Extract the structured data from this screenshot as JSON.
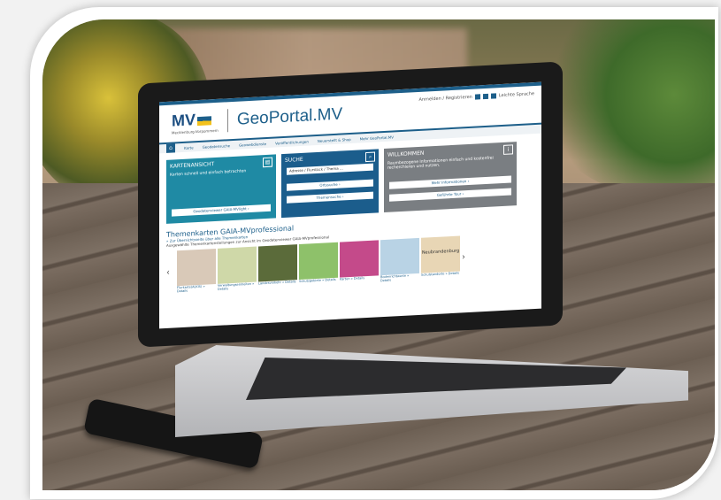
{
  "site": {
    "logo_text": "MV",
    "logo_sub": "Mecklenburg-Vorpommern",
    "title": "GeoPortal.MV",
    "header_links": "Anmelden / Registrieren",
    "lang_link": "Leichte Sprache"
  },
  "nav": [
    "Karte",
    "Geodatensuche",
    "Geowebdienste",
    "Veröffentlichungen",
    "Neuerstellt & Shop",
    "Mehr GeoPortal.MV"
  ],
  "boxes": {
    "karten": {
      "title": "KARTENANSICHT",
      "text": "Karten schnell und einfach betrachten",
      "button": "Geodatenviewer GAIA-MVlight ›"
    },
    "suche": {
      "title": "SUCHE",
      "placeholder": "Adresse / Flurstück / Thema ...",
      "buttons": [
        "Ortssuche ›",
        "Themensuche ›"
      ]
    },
    "willkommen": {
      "title": "WILLKOMMEN",
      "text": "Raumbezogene Informationen einfach und kostenfrei recherchieren und nutzen.",
      "buttons": [
        "Mehr Informationen ›",
        "Geführte Tour ›"
      ]
    }
  },
  "themen": {
    "heading": "Themenkarten GAIA-MVprofessional",
    "link": "» Zur Übersichtsseite über alle Themenkarten",
    "text": "Ausgewählte Themenkartenstellungen zur Ansicht im Geodatenviewer GAIA-MVprofessional",
    "thumbs": [
      {
        "caption": "Flurkarte(ALKIS) » Details",
        "color": "#d9c9b8"
      },
      {
        "caption": "Verwaltungseinheiten » Details",
        "color": "#cfd8a8"
      },
      {
        "caption": "Landesverkehr » Details",
        "color": "#5b6b3a"
      },
      {
        "caption": "Schutzgebiete » Details",
        "color": "#8ec16a"
      },
      {
        "caption": "Karten » Details",
        "color": "#c44a8a"
      },
      {
        "caption": "Bodenrichtwerte » Details",
        "color": "#b9d3e5"
      },
      {
        "caption": "Schulstandorte » Details",
        "color": "#e8d6b5"
      }
    ],
    "thumb_label": "Neubrandenburg"
  },
  "colors": {
    "karten": "#1f8aa4",
    "suche": "#1b5d8c",
    "willkommen": "#7a7e82",
    "brand": "#1d5f8a"
  }
}
